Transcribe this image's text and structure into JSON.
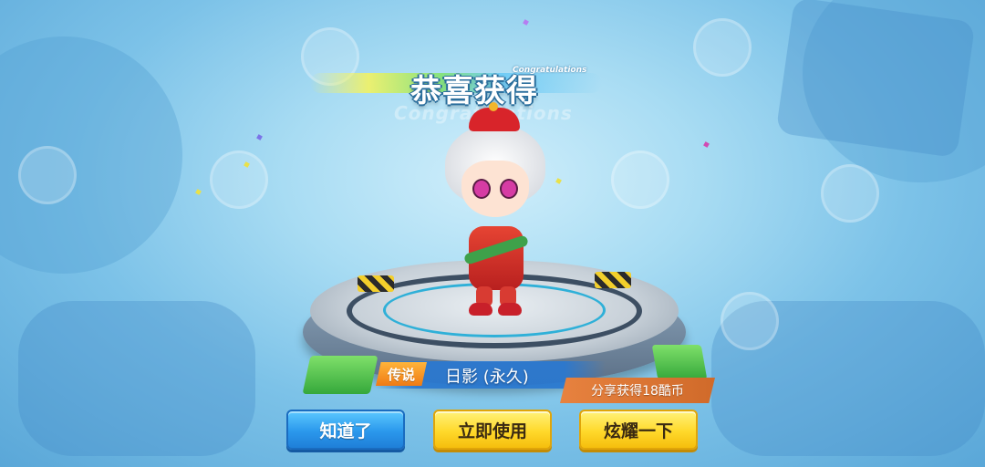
{
  "title": {
    "main": "恭喜获得",
    "sub": "Congratulations",
    "ghost": "Congratulations"
  },
  "item": {
    "rarity": "传说",
    "name": "日影 (永久)"
  },
  "share_reward": "分享获得18酷币",
  "buttons": {
    "ok": "知道了",
    "use_now": "立即使用",
    "show_off": "炫耀一下"
  },
  "colors": {
    "button_blue": "#2b98ec",
    "button_yellow": "#ffd92b",
    "rarity_orange": "#ef7b15",
    "share_orange": "#e7823f"
  }
}
